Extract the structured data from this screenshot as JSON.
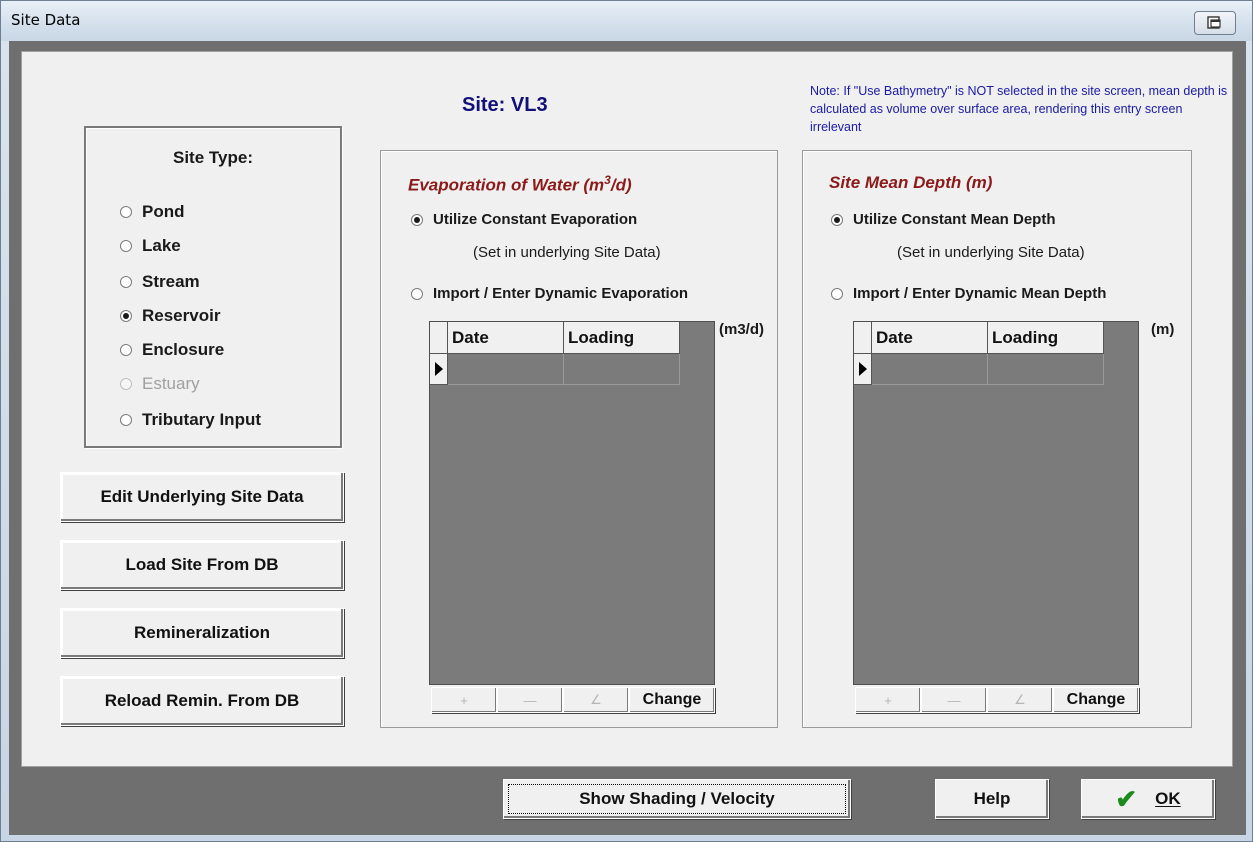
{
  "window": {
    "title": "Site Data"
  },
  "site": {
    "title": "Site: VL3"
  },
  "note": "Note:  If \"Use Bathymetry\" is NOT selected in the site screen, mean depth is calculated as volume over surface area, rendering this entry screen irrelevant",
  "site_type": {
    "title": "Site Type:",
    "options": [
      {
        "label": "Pond",
        "checked": false,
        "enabled": true
      },
      {
        "label": "Lake",
        "checked": false,
        "enabled": true
      },
      {
        "label": "Stream",
        "checked": false,
        "enabled": true
      },
      {
        "label": "Reservoir",
        "checked": true,
        "enabled": true
      },
      {
        "label": "Enclosure",
        "checked": false,
        "enabled": true
      },
      {
        "label": "Estuary",
        "checked": false,
        "enabled": false
      },
      {
        "label": "Tributary Input",
        "checked": false,
        "enabled": true
      }
    ]
  },
  "left_buttons": {
    "edit_underlying": "Edit Underlying Site Data",
    "load_site": "Load Site From DB",
    "remineralization": "Remineralization",
    "reload_remin": "Reload Remin. From DB"
  },
  "evaporation": {
    "title_pre": "Evaporation of Water (m",
    "title_sup": "3",
    "title_post": "/d)",
    "option_constant": "Utilize Constant Evaporation",
    "constant_note": "(Set in underlying Site Data)",
    "option_dynamic": "Import / Enter Dynamic Evaporation",
    "selected": "constant",
    "unit": "(m3/d)",
    "columns": [
      "Date",
      "Loading"
    ],
    "change_label": "Change"
  },
  "mean_depth": {
    "title": "Site Mean Depth (m)",
    "option_constant": "Utilize Constant Mean Depth",
    "constant_note": "(Set in underlying Site Data)",
    "option_dynamic": "Import / Enter Dynamic Mean Depth",
    "selected": "constant",
    "unit": "(m)",
    "columns": [
      "Date",
      "Loading"
    ],
    "change_label": "Change"
  },
  "nav_glyphs": {
    "insert": "+",
    "delete": "—",
    "edit": "∠"
  },
  "bottom": {
    "show_shading": "Show Shading / Velocity",
    "help": "Help",
    "ok": "OK"
  },
  "colors": {
    "group_title": "#8b1a1a",
    "site_title": "#101078",
    "note": "#1a1aa6",
    "ok_check": "#1c8a1c"
  }
}
